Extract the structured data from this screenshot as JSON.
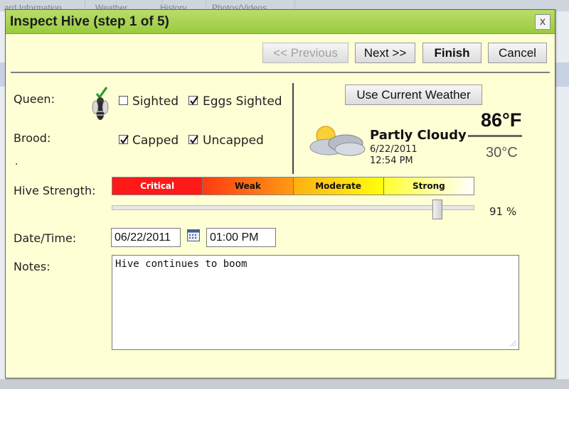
{
  "background": {
    "tabs": [
      "ard Information",
      "Weather",
      "History",
      "Photos/Videos"
    ]
  },
  "dialog": {
    "title": "Inspect Hive (step 1 of 5)",
    "close_label": "x"
  },
  "toolbar": {
    "previous_label": "<< Previous",
    "previous_enabled": false,
    "next_label": "Next >>",
    "finish_label": "Finish",
    "cancel_label": "Cancel"
  },
  "queen": {
    "label": "Queen:",
    "icon": "queen-bee-icon",
    "sighted_label": "Sighted",
    "sighted_checked": false,
    "eggs_label": "Eggs Sighted",
    "eggs_checked": true
  },
  "brood": {
    "label": "Brood:",
    "capped_label": "Capped",
    "capped_checked": true,
    "uncapped_label": "Uncapped",
    "uncapped_checked": true,
    "extra": "."
  },
  "weather": {
    "button_label": "Use Current Weather",
    "icon": "partly-cloudy-icon",
    "condition": "Partly Cloudy",
    "date": "6/22/2011",
    "time": "12:54 PM",
    "temp_f": "86°F",
    "temp_c": "30°C"
  },
  "strength": {
    "label": "Hive Strength:",
    "segments": [
      "Critical",
      "Weak",
      "Moderate",
      "Strong"
    ],
    "value": 91,
    "percent_text": "91 %"
  },
  "datetime": {
    "label": "Date/Time:",
    "date_value": "06/22/2011",
    "time_value": "01:00 PM",
    "icon": "calendar-icon"
  },
  "notes": {
    "label": "Notes:",
    "value": "Hive continues to boom"
  },
  "colors": {
    "dialog_bg": "#ffffd6",
    "titlebar": "#9acb3e",
    "critical": "#ff1a1a"
  }
}
